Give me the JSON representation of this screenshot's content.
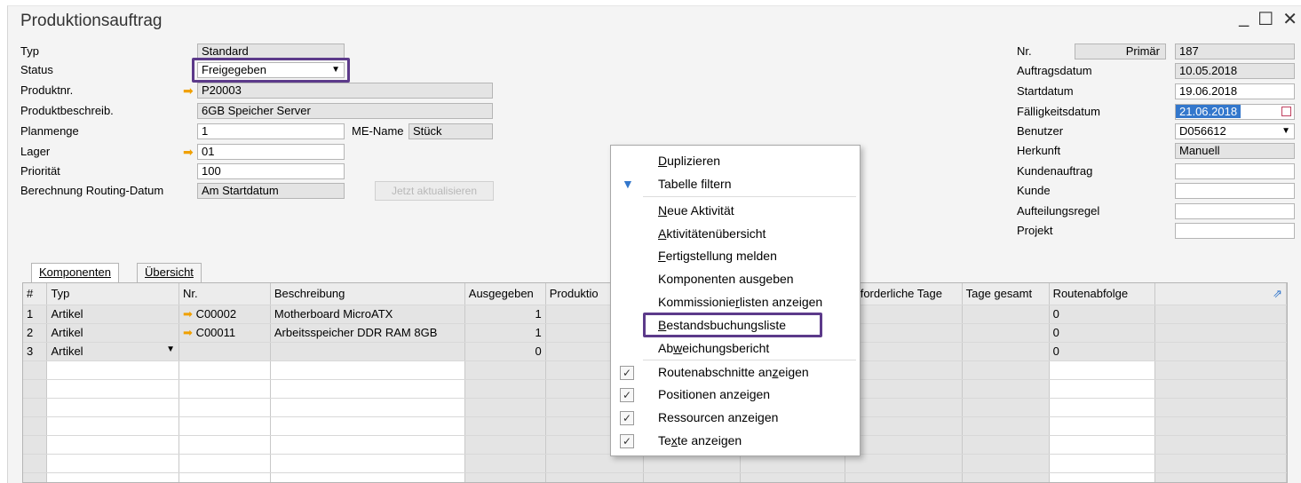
{
  "window": {
    "title": "Produktionsauftrag",
    "minimize": "_",
    "maximize": "☐",
    "close": "✕"
  },
  "left": {
    "typ": {
      "label": "Typ",
      "value": "Standard"
    },
    "status": {
      "label": "Status",
      "value": "Freigegeben"
    },
    "produktnr": {
      "label": "Produktnr.",
      "value": "P20003"
    },
    "produktbeschreib": {
      "label": "Produktbeschreib.",
      "value": "6GB Speicher Server"
    },
    "planmenge": {
      "label": "Planmenge",
      "value": "1"
    },
    "me_name": {
      "label": "ME-Name",
      "value": "Stück"
    },
    "lager": {
      "label": "Lager",
      "value": "01"
    },
    "prioritaet": {
      "label": "Priorität",
      "value": "100"
    },
    "routing": {
      "label": "Berechnung Routing-Datum",
      "value": "Am Startdatum"
    },
    "update_button": "Jetzt aktualisieren"
  },
  "right": {
    "nr": {
      "label": "Nr.",
      "series": "Primär",
      "value": "187"
    },
    "auftragsdatum": {
      "label": "Auftragsdatum",
      "value": "10.05.2018"
    },
    "startdatum": {
      "label": "Startdatum",
      "value": "19.06.2018"
    },
    "faelligkeitsdatum": {
      "label": "Fälligkeitsdatum",
      "value": "21.06.2018"
    },
    "benutzer": {
      "label": "Benutzer",
      "value": "D056612"
    },
    "herkunft": {
      "label": "Herkunft",
      "value": "Manuell"
    },
    "kundenauftrag": {
      "label": "Kundenauftrag",
      "value": ""
    },
    "kunde": {
      "label": "Kunde",
      "value": ""
    },
    "aufteilungsregel": {
      "label": "Aufteilungsregel",
      "value": ""
    },
    "projekt": {
      "label": "Projekt",
      "value": ""
    }
  },
  "tabs": [
    {
      "label": "Komponenten"
    },
    {
      "label": "Übersicht"
    }
  ],
  "grid": {
    "columns": [
      "#",
      "Typ",
      "Nr.",
      "Beschreibung",
      "Ausgegeben",
      "Produktio",
      "",
      "",
      "Erforderliche Tage",
      "Tage gesamt",
      "Routenabfolge",
      ""
    ],
    "rows": [
      {
        "n": "1",
        "typ": "Artikel",
        "nr": "C00002",
        "beschreibung": "Motherboard MicroATX",
        "ausgegeben": "1",
        "route": "0"
      },
      {
        "n": "2",
        "typ": "Artikel",
        "nr": "C00011",
        "beschreibung": "Arbeitsspeicher DDR RAM 8GB",
        "ausgegeben": "1",
        "route": "0"
      },
      {
        "n": "3",
        "typ": "Artikel",
        "nr": "",
        "beschreibung": "",
        "ausgegeben": "0",
        "route": "0"
      }
    ]
  },
  "context_menu": {
    "items": [
      {
        "label": "Duplizieren"
      },
      {
        "label": "Tabelle filtern"
      },
      {
        "label": "Neue Aktivität"
      },
      {
        "label": "Aktivitätenübersicht"
      },
      {
        "label": "Fertigstellung melden"
      },
      {
        "label": "Komponenten ausgeben"
      },
      {
        "label": "Kommissionierlisten anzeigen"
      },
      {
        "label": "Bestandsbuchungsliste"
      },
      {
        "label": "Abweichungsbericht"
      },
      {
        "label": "Routenabschnitte anzeigen"
      },
      {
        "label": "Positionen anzeigen"
      },
      {
        "label": "Ressourcen anzeigen"
      },
      {
        "label": "Texte anzeigen"
      }
    ],
    "check_mark": "✓"
  },
  "colors": {
    "highlight": "#5c3a8a",
    "link_arrow": "#f0a000",
    "selection": "#3377cc"
  }
}
